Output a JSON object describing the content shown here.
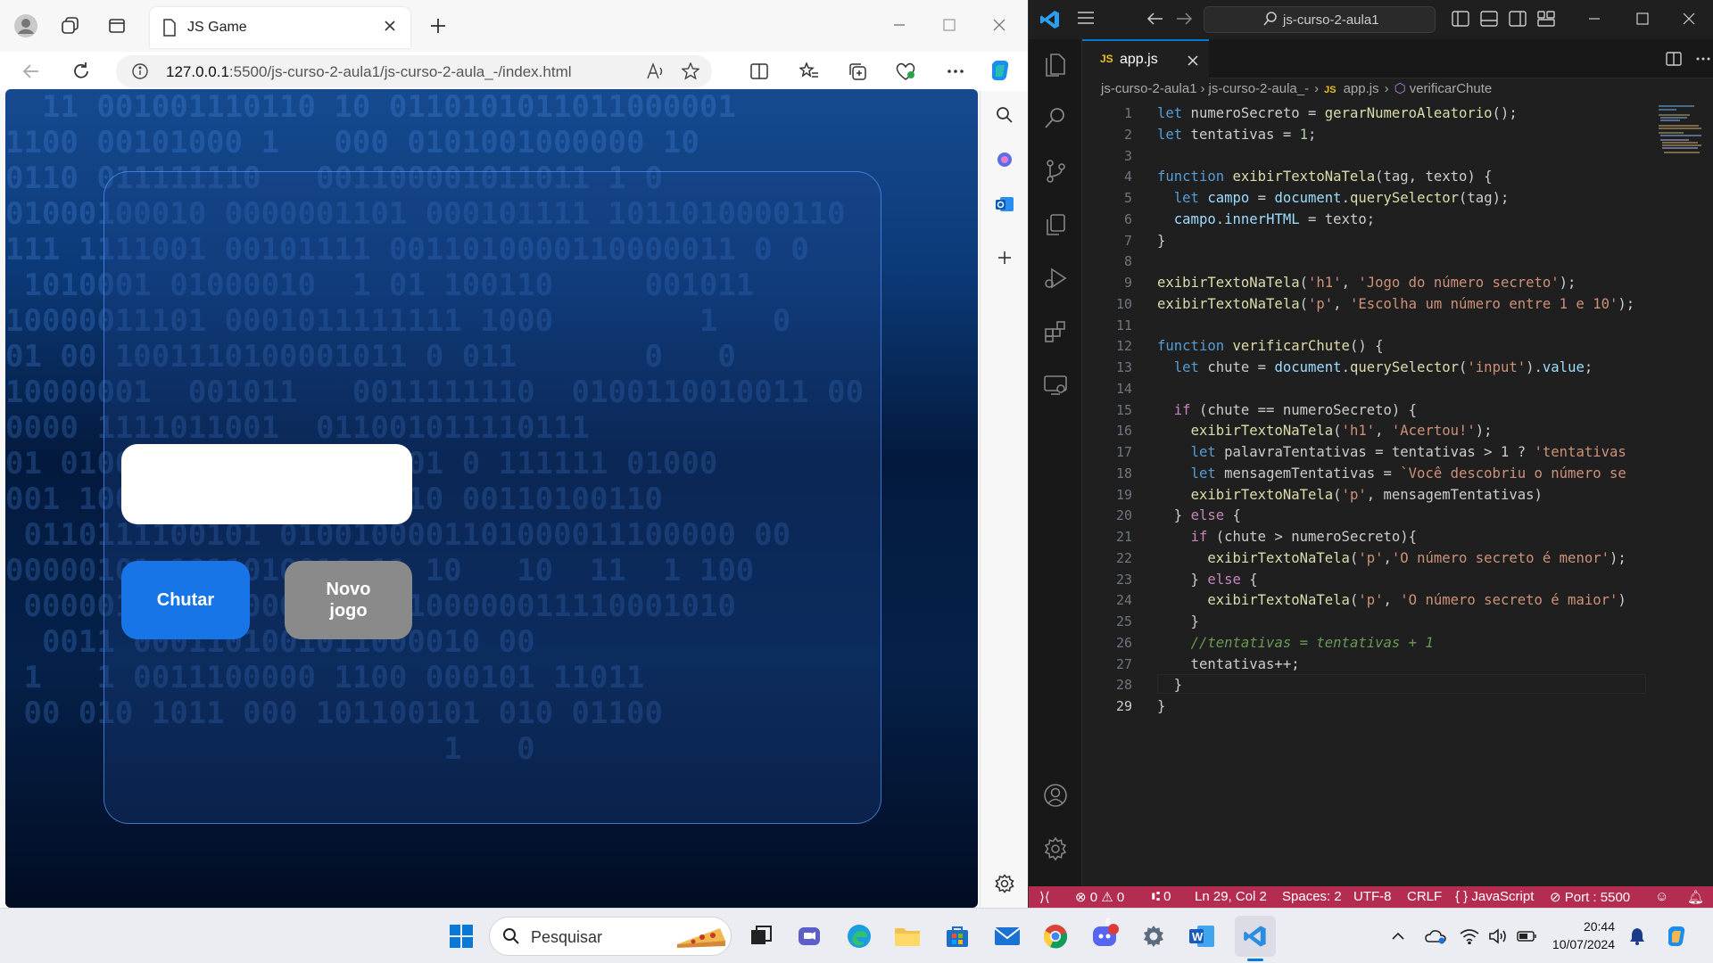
{
  "browser": {
    "tab_title": "JS Game",
    "url_host": "127.0.0.1",
    "url_path": ":5500/js-curso-2-aula1/js-curso-2-aula_-/index.html",
    "page": {
      "binary_rows": [
        "  11 001001110110 10 0110101011011000001",
        "1100 00101000 1   000 0101001000000 10",
        "0110 011111110   001100001011011 1 0",
        "01000100010 0000001101 000101111 1011010000110",
        "111 1111001 00101111 0011010000110000011 0 0",
        " 1010001 01000010  1 01 100110     001011",
        "10000011101 0001011111111 1000        1   0",
        "01 00 1001110100001011 0 011       0   0",
        "10000001  001011   0011111110  0100110010011 00",
        "0000 1111011001  011001011110111",
        "01 010000111001110100001 0 111111 01000",
        "001 10000101101 01100110 00110100110",
        " 0110111100101 0100100001101000011100000 00",
        "00000101 1011010010 11 10   10  11  1 100",
        " 000001010 000000 0001100000011110001010",
        "  0011 0001101001011000010 00",
        " 1   1 0011100000 1100 000101 11011",
        " 00 010 1011 000 101100101 010 01100",
        "                        1   0"
      ],
      "input_value": "",
      "btn_guess": "Chutar",
      "btn_new": "Novo jogo"
    }
  },
  "vscode": {
    "search_text": "js-curso-2-aula1",
    "tab_label": "app.js",
    "tab_lang_badge": "JS",
    "breadcrumb": [
      "js-curso-2-aula1",
      "js-curso-2-aula_-",
      "app.js",
      "verificarChute"
    ],
    "code_lines": [
      "let numeroSecreto = gerarNumeroAleatorio();",
      "let tentativas = 1;",
      "",
      "function exibirTextoNaTela(tag, texto) {",
      "  let campo = document.querySelector(tag);",
      "  campo.innerHTML = texto;",
      "}",
      "",
      "exibirTextoNaTela('h1', 'Jogo do número secreto');",
      "exibirTextoNaTela('p', 'Escolha um número entre 1 e 10');",
      "",
      "function verificarChute() {",
      "  let chute = document.querySelector('input').value;",
      "",
      "  if (chute == numeroSecreto) {",
      "    exibirTextoNaTela('h1', 'Acertou!');",
      "    let palavraTentativas = tentativas > 1 ? 'tentativas",
      "    let mensagemTentativas = `Você descobriu o número se",
      "    exibirTextoNaTela('p', mensagemTentativas)",
      "  } else {",
      "    if (chute > numeroSecreto){",
      "      exibirTextoNaTela('p','O número secreto é menor');",
      "    } else {",
      "      exibirTextoNaTela('p', 'O número secreto é maior')",
      "    }",
      "    //tentativas = tentativas + 1",
      "    tentativas++;",
      "  }",
      "}"
    ],
    "status": {
      "errors": "0",
      "warnings": "0",
      "ports": "0",
      "position": "Ln 29, Col 2",
      "spaces": "Spaces: 2",
      "encoding": "UTF-8",
      "eol": "CRLF",
      "language": "JavaScript",
      "port": "Port : 5500"
    },
    "colors": {
      "status_bar": "#b42d51",
      "accent": "#0078d4"
    }
  },
  "taskbar": {
    "search_placeholder": "Pesquisar",
    "time": "20:44",
    "date": "10/07/2024",
    "discord_badge": "6"
  }
}
